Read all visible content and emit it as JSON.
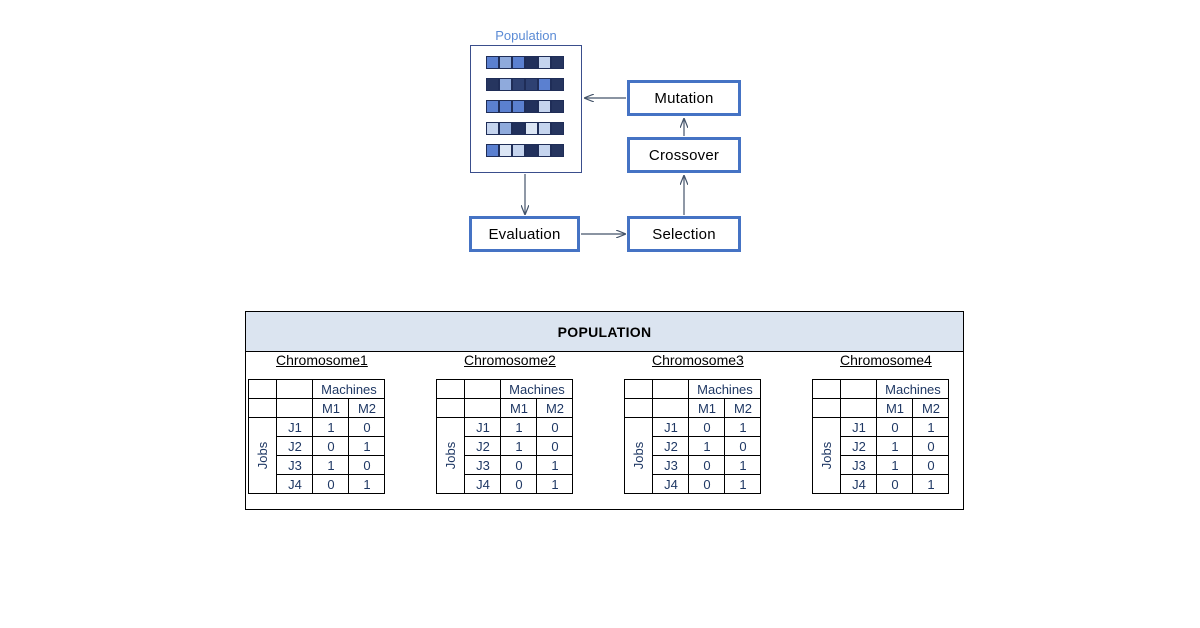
{
  "flowchart": {
    "population_label": "Population",
    "boxes": [
      {
        "id": "mutation",
        "label": "Mutation"
      },
      {
        "id": "crossover",
        "label": "Crossover"
      },
      {
        "id": "selection",
        "label": "Selection"
      },
      {
        "id": "evaluation",
        "label": "Evaluation"
      }
    ],
    "population_grid": {
      "rows": 5,
      "cols": 6,
      "colors": [
        [
          "#5B80D0",
          "#8FAADC",
          "#5B80D0",
          "#21305C",
          "#C5D4EE",
          "#26355F"
        ],
        [
          "#26355F",
          "#8FAADC",
          "#2E4172",
          "#2E4172",
          "#5B80D0",
          "#26355F"
        ],
        [
          "#5B80D0",
          "#5B80D0",
          "#5B80D0",
          "#21305C",
          "#C5D4EE",
          "#26355F"
        ],
        [
          "#C5D4EE",
          "#8FAADC",
          "#21305C",
          "#DCE6F5",
          "#C5D4EE",
          "#26355F"
        ],
        [
          "#5B80D0",
          "#DCE6F5",
          "#C5D4EE",
          "#21305C",
          "#C5D4EE",
          "#26355F"
        ]
      ]
    },
    "colors": {
      "box_border": "#4573C4",
      "label_text": "#5B8BD5",
      "frame_border": "#3A4E8C",
      "arrow": "#44546A"
    }
  },
  "panel": {
    "header_title": "POPULATION",
    "header_bg": "#DBE4F0",
    "on_color": "#5CE05C",
    "machines_header": "Machines",
    "jobs_header": "Jobs",
    "machine_labels": [
      "M1",
      "M2"
    ],
    "job_labels": [
      "J1",
      "J2",
      "J3",
      "J4"
    ],
    "chromosomes": [
      {
        "title": "Chromosome1",
        "rows": [
          {
            "job": "J1",
            "values": [
              "1",
              "0"
            ]
          },
          {
            "job": "J2",
            "values": [
              "0",
              "1"
            ]
          },
          {
            "job": "J3",
            "values": [
              "1",
              "0"
            ]
          },
          {
            "job": "J4",
            "values": [
              "0",
              "1"
            ]
          }
        ]
      },
      {
        "title": "Chromosome2",
        "rows": [
          {
            "job": "J1",
            "values": [
              "1",
              "0"
            ]
          },
          {
            "job": "J2",
            "values": [
              "1",
              "0"
            ]
          },
          {
            "job": "J3",
            "values": [
              "0",
              "1"
            ]
          },
          {
            "job": "J4",
            "values": [
              "0",
              "1"
            ]
          }
        ]
      },
      {
        "title": "Chromosome3",
        "rows": [
          {
            "job": "J1",
            "values": [
              "0",
              "1"
            ]
          },
          {
            "job": "J2",
            "values": [
              "1",
              "0"
            ]
          },
          {
            "job": "J3",
            "values": [
              "0",
              "1"
            ]
          },
          {
            "job": "J4",
            "values": [
              "0",
              "1"
            ]
          }
        ]
      },
      {
        "title": "Chromosome4",
        "rows": [
          {
            "job": "J1",
            "values": [
              "0",
              "1"
            ]
          },
          {
            "job": "J2",
            "values": [
              "1",
              "0"
            ]
          },
          {
            "job": "J3",
            "values": [
              "1",
              "0"
            ]
          },
          {
            "job": "J4",
            "values": [
              "0",
              "1"
            ]
          }
        ]
      }
    ]
  }
}
